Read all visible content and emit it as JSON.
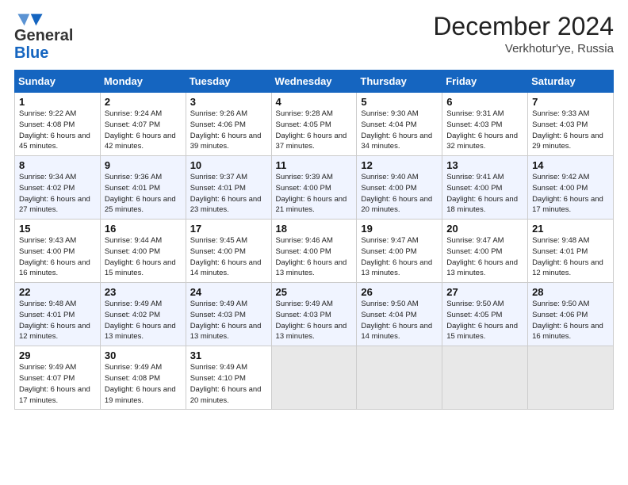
{
  "header": {
    "logo_line1": "General",
    "logo_line2": "Blue",
    "month": "December 2024",
    "location": "Verkhotur'ye, Russia"
  },
  "weekdays": [
    "Sunday",
    "Monday",
    "Tuesday",
    "Wednesday",
    "Thursday",
    "Friday",
    "Saturday"
  ],
  "weeks": [
    [
      {
        "day": "1",
        "sunrise": "9:22 AM",
        "sunset": "4:08 PM",
        "daylight": "6 hours and 45 minutes."
      },
      {
        "day": "2",
        "sunrise": "9:24 AM",
        "sunset": "4:07 PM",
        "daylight": "6 hours and 42 minutes."
      },
      {
        "day": "3",
        "sunrise": "9:26 AM",
        "sunset": "4:06 PM",
        "daylight": "6 hours and 39 minutes."
      },
      {
        "day": "4",
        "sunrise": "9:28 AM",
        "sunset": "4:05 PM",
        "daylight": "6 hours and 37 minutes."
      },
      {
        "day": "5",
        "sunrise": "9:30 AM",
        "sunset": "4:04 PM",
        "daylight": "6 hours and 34 minutes."
      },
      {
        "day": "6",
        "sunrise": "9:31 AM",
        "sunset": "4:03 PM",
        "daylight": "6 hours and 32 minutes."
      },
      {
        "day": "7",
        "sunrise": "9:33 AM",
        "sunset": "4:03 PM",
        "daylight": "6 hours and 29 minutes."
      }
    ],
    [
      {
        "day": "8",
        "sunrise": "9:34 AM",
        "sunset": "4:02 PM",
        "daylight": "6 hours and 27 minutes."
      },
      {
        "day": "9",
        "sunrise": "9:36 AM",
        "sunset": "4:01 PM",
        "daylight": "6 hours and 25 minutes."
      },
      {
        "day": "10",
        "sunrise": "9:37 AM",
        "sunset": "4:01 PM",
        "daylight": "6 hours and 23 minutes."
      },
      {
        "day": "11",
        "sunrise": "9:39 AM",
        "sunset": "4:00 PM",
        "daylight": "6 hours and 21 minutes."
      },
      {
        "day": "12",
        "sunrise": "9:40 AM",
        "sunset": "4:00 PM",
        "daylight": "6 hours and 20 minutes."
      },
      {
        "day": "13",
        "sunrise": "9:41 AM",
        "sunset": "4:00 PM",
        "daylight": "6 hours and 18 minutes."
      },
      {
        "day": "14",
        "sunrise": "9:42 AM",
        "sunset": "4:00 PM",
        "daylight": "6 hours and 17 minutes."
      }
    ],
    [
      {
        "day": "15",
        "sunrise": "9:43 AM",
        "sunset": "4:00 PM",
        "daylight": "6 hours and 16 minutes."
      },
      {
        "day": "16",
        "sunrise": "9:44 AM",
        "sunset": "4:00 PM",
        "daylight": "6 hours and 15 minutes."
      },
      {
        "day": "17",
        "sunrise": "9:45 AM",
        "sunset": "4:00 PM",
        "daylight": "6 hours and 14 minutes."
      },
      {
        "day": "18",
        "sunrise": "9:46 AM",
        "sunset": "4:00 PM",
        "daylight": "6 hours and 13 minutes."
      },
      {
        "day": "19",
        "sunrise": "9:47 AM",
        "sunset": "4:00 PM",
        "daylight": "6 hours and 13 minutes."
      },
      {
        "day": "20",
        "sunrise": "9:47 AM",
        "sunset": "4:00 PM",
        "daylight": "6 hours and 13 minutes."
      },
      {
        "day": "21",
        "sunrise": "9:48 AM",
        "sunset": "4:01 PM",
        "daylight": "6 hours and 12 minutes."
      }
    ],
    [
      {
        "day": "22",
        "sunrise": "9:48 AM",
        "sunset": "4:01 PM",
        "daylight": "6 hours and 12 minutes."
      },
      {
        "day": "23",
        "sunrise": "9:49 AM",
        "sunset": "4:02 PM",
        "daylight": "6 hours and 13 minutes."
      },
      {
        "day": "24",
        "sunrise": "9:49 AM",
        "sunset": "4:03 PM",
        "daylight": "6 hours and 13 minutes."
      },
      {
        "day": "25",
        "sunrise": "9:49 AM",
        "sunset": "4:03 PM",
        "daylight": "6 hours and 13 minutes."
      },
      {
        "day": "26",
        "sunrise": "9:50 AM",
        "sunset": "4:04 PM",
        "daylight": "6 hours and 14 minutes."
      },
      {
        "day": "27",
        "sunrise": "9:50 AM",
        "sunset": "4:05 PM",
        "daylight": "6 hours and 15 minutes."
      },
      {
        "day": "28",
        "sunrise": "9:50 AM",
        "sunset": "4:06 PM",
        "daylight": "6 hours and 16 minutes."
      }
    ],
    [
      {
        "day": "29",
        "sunrise": "9:49 AM",
        "sunset": "4:07 PM",
        "daylight": "6 hours and 17 minutes."
      },
      {
        "day": "30",
        "sunrise": "9:49 AM",
        "sunset": "4:08 PM",
        "daylight": "6 hours and 19 minutes."
      },
      {
        "day": "31",
        "sunrise": "9:49 AM",
        "sunset": "4:10 PM",
        "daylight": "6 hours and 20 minutes."
      },
      null,
      null,
      null,
      null
    ]
  ],
  "labels": {
    "sunrise": "Sunrise:",
    "sunset": "Sunset:",
    "daylight": "Daylight hours"
  }
}
